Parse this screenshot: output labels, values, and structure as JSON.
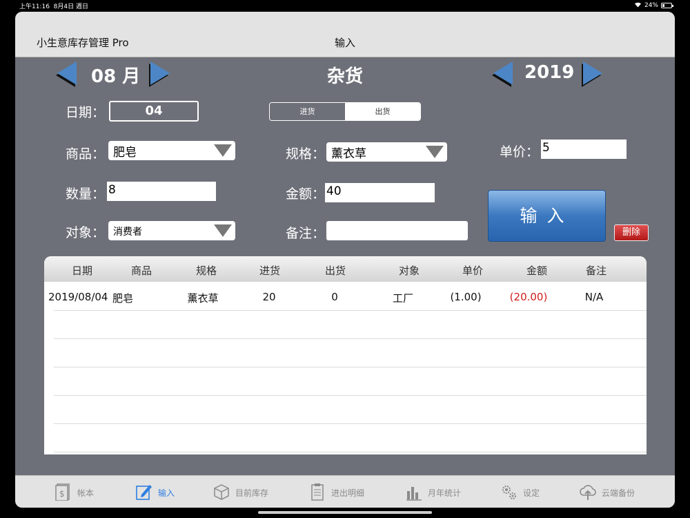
{
  "status": {
    "time": "上午11:16",
    "date": "8月4日 週日",
    "battery": "24%"
  },
  "topbar": {
    "app_title": "小生意库存管理 Pro",
    "page_title": "输入"
  },
  "header": {
    "month": "08 月",
    "category": "杂货",
    "year": "2019"
  },
  "form": {
    "date_label": "日期：",
    "date_value": "04",
    "segment": [
      "进货",
      "出货"
    ],
    "product_label": "商品：",
    "product_value": "肥皂",
    "spec_label": "规格：",
    "spec_value": "薰衣草",
    "price_label": "单价：",
    "price_value": "5",
    "qty_label": "数量：",
    "qty_value": "8",
    "amount_label": "金额：",
    "amount_value": "40",
    "target_label": "对象：",
    "target_value": "消费者",
    "note_label": "备注：",
    "note_value": "",
    "enter_button": "输入",
    "delete_button": "删除"
  },
  "table": {
    "headers": [
      "日期",
      "商品",
      "规格",
      "进货",
      "出货",
      "对象",
      "单价",
      "金额",
      "备注"
    ],
    "rows": [
      [
        "2019/08/04",
        "肥皂",
        "薰衣草",
        "20",
        "0",
        "工厂",
        "(1.00)",
        "(20.00)",
        "N/A"
      ]
    ]
  },
  "tabbar": [
    {
      "label": "帐本",
      "icon": "ledger-icon"
    },
    {
      "label": "输入",
      "icon": "edit-icon",
      "active": true
    },
    {
      "label": "目前库存",
      "icon": "box-icon"
    },
    {
      "label": "进出明细",
      "icon": "clipboard-icon"
    },
    {
      "label": "月年统计",
      "icon": "bar-chart-icon"
    },
    {
      "label": "设定",
      "icon": "gears-icon"
    },
    {
      "label": "云端备份",
      "icon": "cloud-upload-icon"
    }
  ],
  "colors": {
    "accent": "#4d86c6",
    "background": "#6e7079",
    "negative": "#d01c1c",
    "active_tab": "#2f7fe0"
  }
}
